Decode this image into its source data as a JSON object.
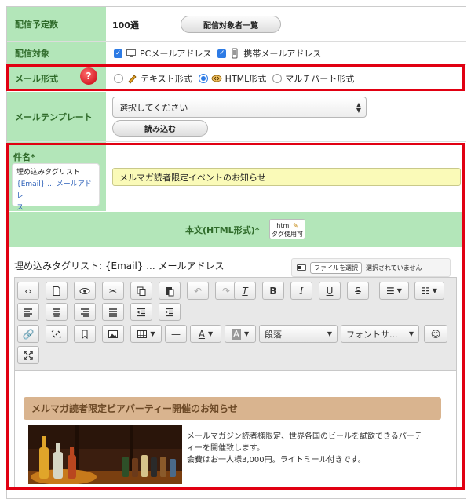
{
  "rows": {
    "delivery_count": {
      "label": "配信予定数",
      "value": "100通",
      "button": "配信対象者一覧"
    },
    "delivery_target": {
      "label": "配信対象",
      "pc": "PCメールアドレス",
      "mobile": "携帯メールアドレス"
    },
    "mail_format": {
      "label": "メール形式",
      "help": "?",
      "options": [
        "テキスト形式",
        "HTML形式",
        "マルチパート形式"
      ],
      "selected": "HTML形式"
    },
    "template": {
      "label": "メールテンプレート",
      "select_value": "選択してください",
      "load_button": "読み込む"
    },
    "subject": {
      "label": "件名*",
      "tags_title": "埋め込みタグリスト",
      "tags_line": "{Email} ... メールアドレス",
      "tags_line_a": "{Email} ... メールアドレ",
      "tags_line_b": "ス",
      "value": "メルマガ読者限定イベントのお知らせ"
    }
  },
  "body_section": {
    "header": "本文(HTML形式)*",
    "tag_badge_top": "html",
    "tag_badge_bottom": "タグ使用可",
    "embed_tags": "埋め込みタグリスト: {Email} ... メールアドレス",
    "file_button": "ファイルを選択",
    "file_status": "選択されていません"
  },
  "toolbar": {
    "paragraph": "段落",
    "font_size": "フォントサ..."
  },
  "editor": {
    "banner": "メルマガ読者限定ビアパーティー開催のお知らせ",
    "text_line1": "メールマガジン読者様限定、世界各国のビールを試飲できるパーテ",
    "text_line2": "ィーを開催致します。",
    "text_line3": "会費はお一人様3,000円。ライトミール付きです。"
  },
  "colors": {
    "label_bg": "#b3e6b9",
    "label_text": "#2f6b2a",
    "highlight": "#e10012",
    "banner": "#d9b48f",
    "subject_bg": "#fafab8"
  }
}
